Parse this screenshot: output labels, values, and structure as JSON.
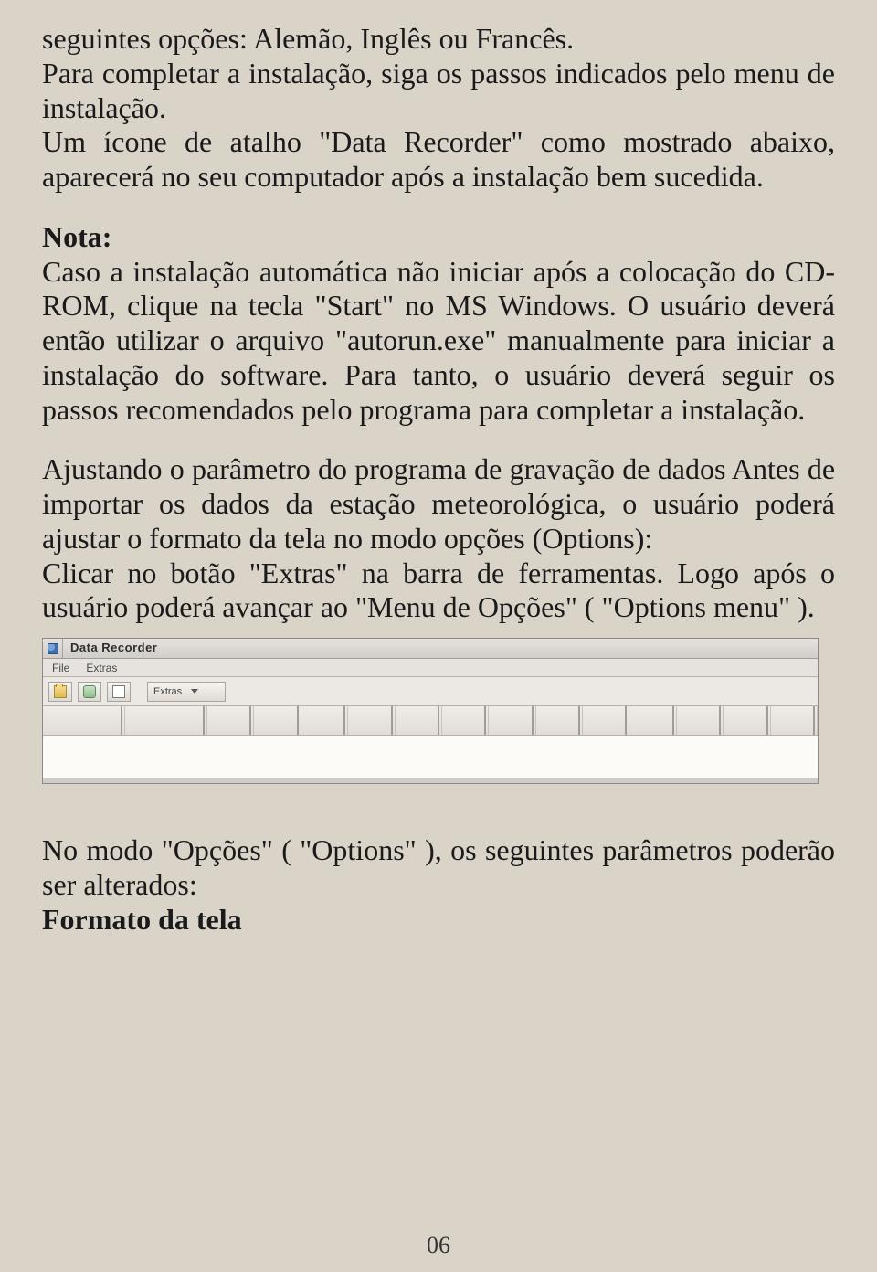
{
  "doc": {
    "para1_line1": "seguintes opções: Alemão, Inglês ou Francês.",
    "para1_rest": "Para completar a instalação, siga os passos indicados pelo menu de instalação.",
    "para2": "Um ícone de atalho \"Data Recorder\" como mostrado abaixo, aparecerá no seu computador após a instalação bem sucedida.",
    "nota_label": "Nota:",
    "nota_body": "Caso a instalação automática não iniciar após a colocação do CD-ROM, clique na tecla \"Start\" no MS Windows. O usuário deverá então utilizar o arquivo \"autorun.exe\" manualmente para iniciar a instalação do software. Para tanto, o usuário deverá seguir os passos recomendados pelo programa para completar a instalação.",
    "sec2_title": "Ajustando o parâmetro do programa de gravação de dados",
    "sec2_body_a": "Antes de importar os dados da estação meteorológica, o usuário poderá ajustar o formato da tela no modo opções (Options):",
    "sec2_body_b": "Clicar no botão \"Extras\" na barra de ferramentas. Logo após o usuário poderá avançar ao \"Menu de Opções\" ( \"Options menu\" ).",
    "postfig": "No modo \"Opções\" ( \"Options\" ), os seguintes parâmetros poderão ser alterados:",
    "display_format_label": "Formato da tela",
    "page_number": "06"
  },
  "screenshot": {
    "window_title": "Data Recorder",
    "menu": [
      "File",
      "Extras"
    ],
    "toolbar": {
      "open_label": "",
      "import_label": "",
      "extras_label": "Extras"
    },
    "grid_headers": [
      "",
      "",
      "",
      "",
      "",
      "",
      "",
      "",
      "",
      "",
      "",
      "",
      "",
      "",
      ""
    ]
  }
}
